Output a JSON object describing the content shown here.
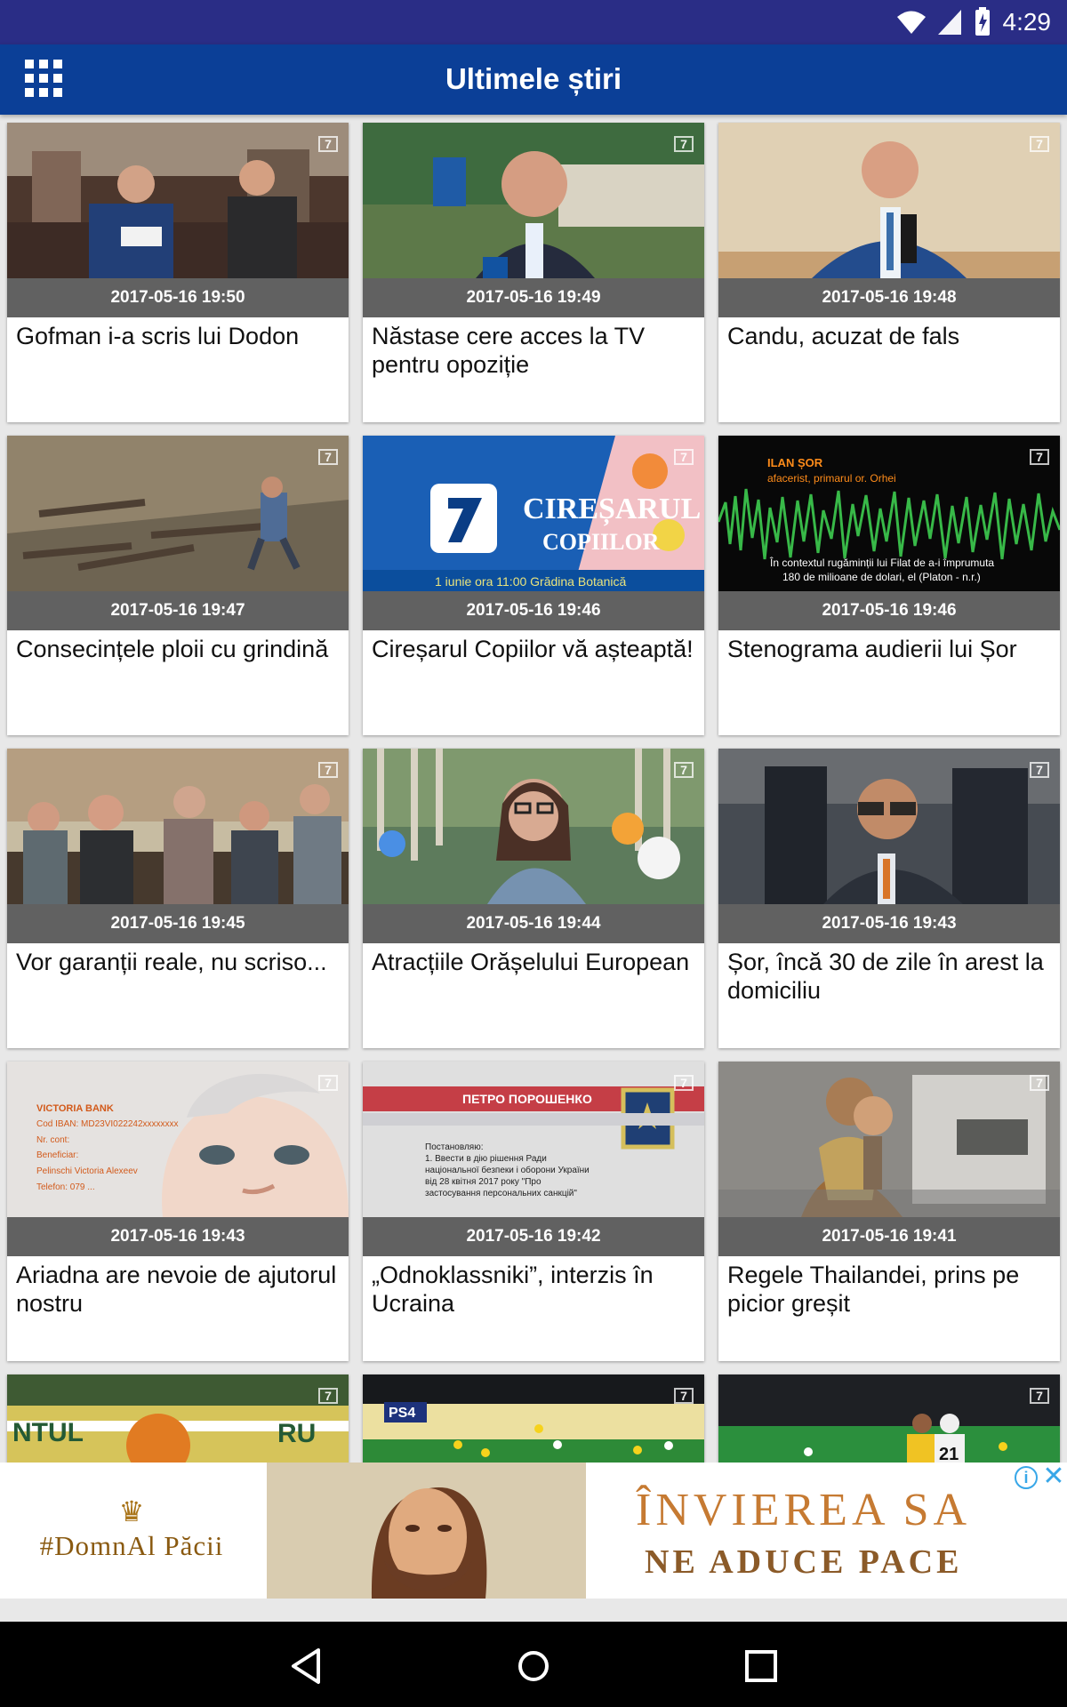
{
  "status": {
    "time": "4:29"
  },
  "header": {
    "title": "Ultimele știri",
    "menu_icon": "apps-grid-icon"
  },
  "colors": {
    "status_bar": "#2a2d86",
    "app_bar": "#0b3f97",
    "date_bar": "#616161",
    "ad_gold": "#c67a32"
  },
  "articles": [
    {
      "date": "2017-05-16  19:50",
      "title": "Gofman i-a scris lui Dodon"
    },
    {
      "date": "2017-05-16  19:49",
      "title": "Năstase cere acces la TV pentru opoziție"
    },
    {
      "date": "2017-05-16  19:48",
      "title": "Candu, acuzat de fals"
    },
    {
      "date": "2017-05-16  19:47",
      "title": "Consecințele ploii cu grindină"
    },
    {
      "date": "2017-05-16  19:46",
      "title": "Cireșarul Copiilor vă așteaptă!"
    },
    {
      "date": "2017-05-16  19:46",
      "title": "Stenograma audierii lui Șor"
    },
    {
      "date": "2017-05-16  19:45",
      "title": "Vor garanții reale, nu scriso..."
    },
    {
      "date": "2017-05-16  19:44",
      "title": "Atracțiile Orășelului European"
    },
    {
      "date": "2017-05-16  19:43",
      "title": "Șor, încă 30 de zile în arest la domiciliu"
    },
    {
      "date": "2017-05-16  19:43",
      "title": "Ariadna are nevoie de ajutorul nostru"
    },
    {
      "date": "2017-05-16  19:42",
      "title": "„Odnoklassniki”, interzis în Ucraina"
    },
    {
      "date": "2017-05-16  19:41",
      "title": "Regele Thailandei, prins pe picior greșit"
    }
  ],
  "partial_cards": [
    "row-5-left",
    "row-5-middle",
    "row-5-right"
  ],
  "ad": {
    "brand": "#DomnAl Păcii",
    "headline": "ÎNVIEREA SA",
    "subline": "NE ADUCE PACE",
    "info": "i",
    "close": "✕"
  }
}
